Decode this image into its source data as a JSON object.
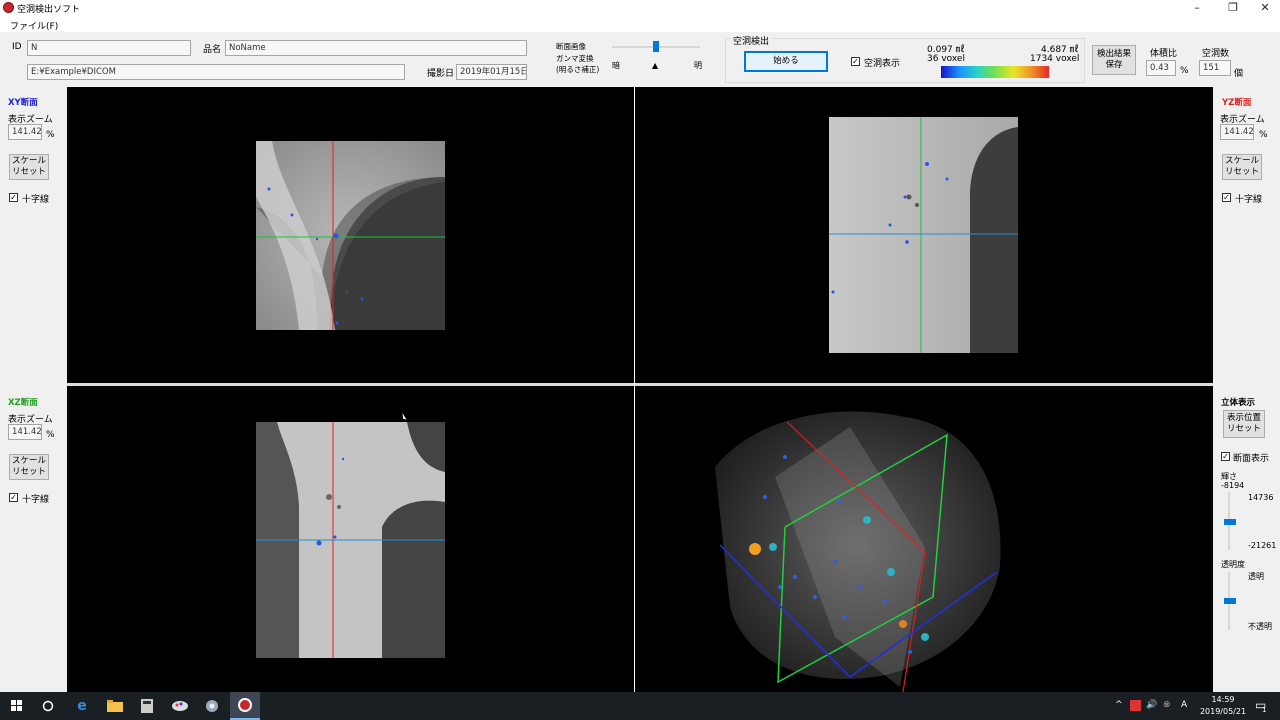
{
  "window": {
    "title": "空洞検出ソフト",
    "minimize": "–",
    "maximize": "❐",
    "close": "✕"
  },
  "menu": {
    "file": "ファイル(F)"
  },
  "toolbar": {
    "id_label": "ID",
    "id_value": "N",
    "name_label": "品名",
    "name_value": "NoName",
    "path_value": "E:¥Example¥DICOM",
    "date_label": "撮影日",
    "date_value": "2019年01月15日",
    "gamma_label_1": "断面画像",
    "gamma_label_2": "ガンマ変換",
    "gamma_label_3": "(明るさ補正)",
    "gamma_dark": "暗",
    "gamma_bright": "明",
    "gamma_marker": "▲",
    "gamma_level": 0.5,
    "detect_group": "空洞検出",
    "start_button": "始める",
    "show_void_label": "空洞表示",
    "show_void_checked": "✓",
    "scale_min_ml": "0.097 ㎖",
    "scale_max_ml": "4.687 ㎖",
    "scale_min_voxel": "36 voxel",
    "scale_max_voxel": "1734 voxel",
    "save_button_1": "検出結果",
    "save_button_2": "保存",
    "volume_ratio_label": "体積比",
    "volume_ratio_value": "0.43",
    "volume_ratio_unit": "%",
    "void_count_label": "空洞数",
    "void_count_value": "151",
    "void_count_unit": "個"
  },
  "panels": {
    "xy": {
      "title": "XY断面",
      "zoom_label": "表示ズーム",
      "zoom_value": "141.42",
      "zoom_unit": "%",
      "reset_1": "スケール",
      "reset_2": "リセット",
      "crosshair": "十字線",
      "crosshair_checked": "✓",
      "color": "#2020d0"
    },
    "yz": {
      "title": "YZ断面",
      "zoom_label": "表示ズーム",
      "zoom_value": "141.42",
      "zoom_unit": "%",
      "reset_1": "スケール",
      "reset_2": "リセット",
      "crosshair": "十字線",
      "crosshair_checked": "✓",
      "color": "#e02020"
    },
    "xz": {
      "title": "XZ断面",
      "zoom_label": "表示ズーム",
      "zoom_value": "141.42",
      "zoom_unit": "%",
      "reset_1": "スケール",
      "reset_2": "リセット",
      "crosshair": "十字線",
      "crosshair_checked": "✓",
      "color": "#20a020"
    },
    "view3d": {
      "title": "立体表示",
      "reset_1": "表示位置",
      "reset_2": "リセット",
      "section_display": "断面表示",
      "section_checked": "✓",
      "brightness_label": "輝さ",
      "brightness_top": "-8194",
      "brightness_max": "14736",
      "brightness_min": "-21261",
      "brightness_level": 0.75,
      "opacity_label": "透明度",
      "opacity_top": "透明",
      "opacity_bottom": "不透明",
      "opacity_level": 0.55
    }
  },
  "taskbar": {
    "time": "14:59",
    "date": "2019/05/21",
    "ime": "A",
    "notification_count": "1"
  }
}
